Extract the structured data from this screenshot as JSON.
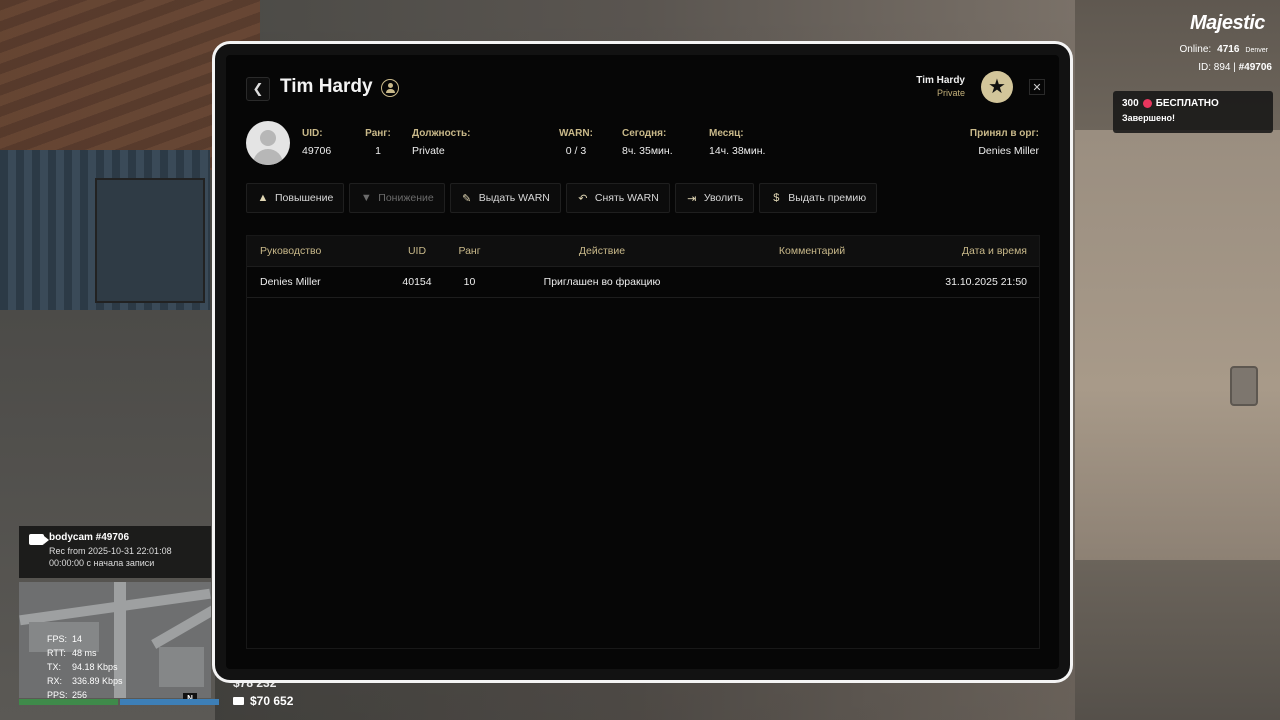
{
  "hud": {
    "logo": "Majestic",
    "online_label": "Online:",
    "online_value": "4716",
    "city": "Denver",
    "id_text": "ID: 894 | ",
    "id_hash": "#49706",
    "notice_amount": "300",
    "notice_label": "БЕСПЛАТНО",
    "notice_status": "Завершено!",
    "brand_color": "#e8365d"
  },
  "bodycam": {
    "title": "bodycam #49706",
    "rec": "Rec from 2025-10-31 22:01:08",
    "elapsed": "00:00:00 с начала записи"
  },
  "stats": [
    {
      "k": "FPS:",
      "v": "14"
    },
    {
      "k": "RTT:",
      "v": "48 ms"
    },
    {
      "k": "TX:",
      "v": "94.18 Kbps"
    },
    {
      "k": "RX:",
      "v": "336.89 Kbps"
    },
    {
      "k": "PPS:",
      "v": "256"
    }
  ],
  "compass": "N",
  "money": {
    "cash": "$78 232",
    "bank": "$70 652"
  },
  "profile": {
    "name": "Tim Hardy",
    "header_name": "Tim Hardy",
    "header_rank": "Private",
    "uid_label": "UID:",
    "uid": "49706",
    "rank_label": "Ранг:",
    "rank": "1",
    "position_label": "Должность:",
    "position": "Private",
    "warn_label": "WARN:",
    "warn": "0 / 3",
    "today_label": "Сегодня:",
    "today": "8ч. 35мин.",
    "month_label": "Месяц:",
    "month": "14ч. 38мин.",
    "accepted_label": "Принял в орг:",
    "accepted": "Denies Miller",
    "accent_color": "#c9b98a"
  },
  "actions": [
    {
      "label": "Повышение",
      "icon": "chevron-up-icon",
      "enabled": true
    },
    {
      "label": "Понижение",
      "icon": "chevron-down-icon",
      "enabled": false
    },
    {
      "label": "Выдать WARN",
      "icon": "document-warn-icon",
      "enabled": true
    },
    {
      "label": "Снять WARN",
      "icon": "undo-icon",
      "enabled": true
    },
    {
      "label": "Уволить",
      "icon": "dismiss-icon",
      "enabled": true
    },
    {
      "label": "Выдать премию",
      "icon": "coin-icon",
      "enabled": true
    }
  ],
  "table": {
    "columns": [
      "Руководство",
      "UID",
      "Ранг",
      "Действие",
      "Комментарий",
      "Дата и время"
    ],
    "rows": [
      [
        "Denies Miller",
        "40154",
        "10",
        "Приглашен во фракцию",
        "",
        "31.10.2025 21:50"
      ]
    ]
  }
}
